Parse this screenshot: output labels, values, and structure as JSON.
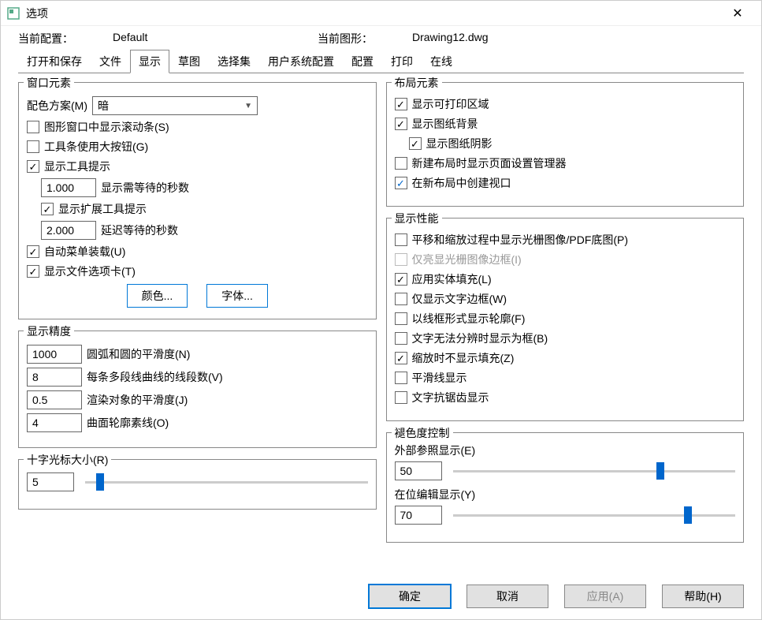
{
  "window": {
    "title": "选项"
  },
  "info": {
    "current_config_label": "当前配置：",
    "current_config_value": "Default",
    "current_drawing_label": "当前图形：",
    "current_drawing_value": "Drawing12.dwg"
  },
  "tabs": {
    "open_save": "打开和保存",
    "file": "文件",
    "display": "显示",
    "sketch": "草图",
    "selection": "选择集",
    "user": "用户系统配置",
    "config": "配置",
    "print": "打印",
    "online": "在线"
  },
  "window_elements": {
    "legend": "窗口元素",
    "color_scheme_label": "配色方案(M)",
    "color_scheme_value": "暗",
    "scrollbars": "图形窗口中显示滚动条(S)",
    "big_buttons": "工具条使用大按钮(G)",
    "tooltips": "显示工具提示",
    "tooltip_seconds_value": "1.000",
    "tooltip_seconds_label": "显示需等待的秒数",
    "ext_tooltips": "显示扩展工具提示",
    "ext_tooltip_seconds_value": "2.000",
    "ext_tooltip_seconds_label": "延迟等待的秒数",
    "auto_menu": "自动菜单装载(U)",
    "file_tabs": "显示文件选项卡(T)",
    "color_btn": "颜色...",
    "font_btn": "字体..."
  },
  "display_precision": {
    "legend": "显示精度",
    "arc_value": "1000",
    "arc_label": "圆弧和圆的平滑度(N)",
    "poly_value": "8",
    "poly_label": "每条多段线曲线的线段数(V)",
    "render_value": "0.5",
    "render_label": "渲染对象的平滑度(J)",
    "surf_value": "4",
    "surf_label": "曲面轮廓素线(O)"
  },
  "crosshair": {
    "legend": "十字光标大小(R)",
    "value": "5"
  },
  "layout_elements": {
    "legend": "布局元素",
    "printable": "显示可打印区域",
    "paper_bg": "显示图纸背景",
    "paper_shadow": "显示图纸阴影",
    "new_layout_pagesetup": "新建布局时显示页面设置管理器",
    "new_layout_viewport": "在新布局中创建视口"
  },
  "display_performance": {
    "legend": "显示性能",
    "pan_zoom_raster": "平移和缩放过程中显示光栅图像/PDF底图(P)",
    "raster_frame": "仅亮显光栅图像边框(I)",
    "solid_fill": "应用实体填充(L)",
    "text_frame": "仅显示文字边框(W)",
    "wire_frame": "以线框形式显示轮廓(F)",
    "text_box": "文字无法分辨时显示为框(B)",
    "no_fill_zoom": "缩放时不显示填充(Z)",
    "smooth_line": "平滑线显示",
    "text_aa": "文字抗锯齿显示"
  },
  "fade_control": {
    "legend": "褪色度控制",
    "xref_label": "外部参照显示(E)",
    "xref_value": "50",
    "inplace_label": "在位编辑显示(Y)",
    "inplace_value": "70"
  },
  "footer": {
    "ok": "确定",
    "cancel": "取消",
    "apply": "应用(A)",
    "help": "帮助(H)"
  }
}
